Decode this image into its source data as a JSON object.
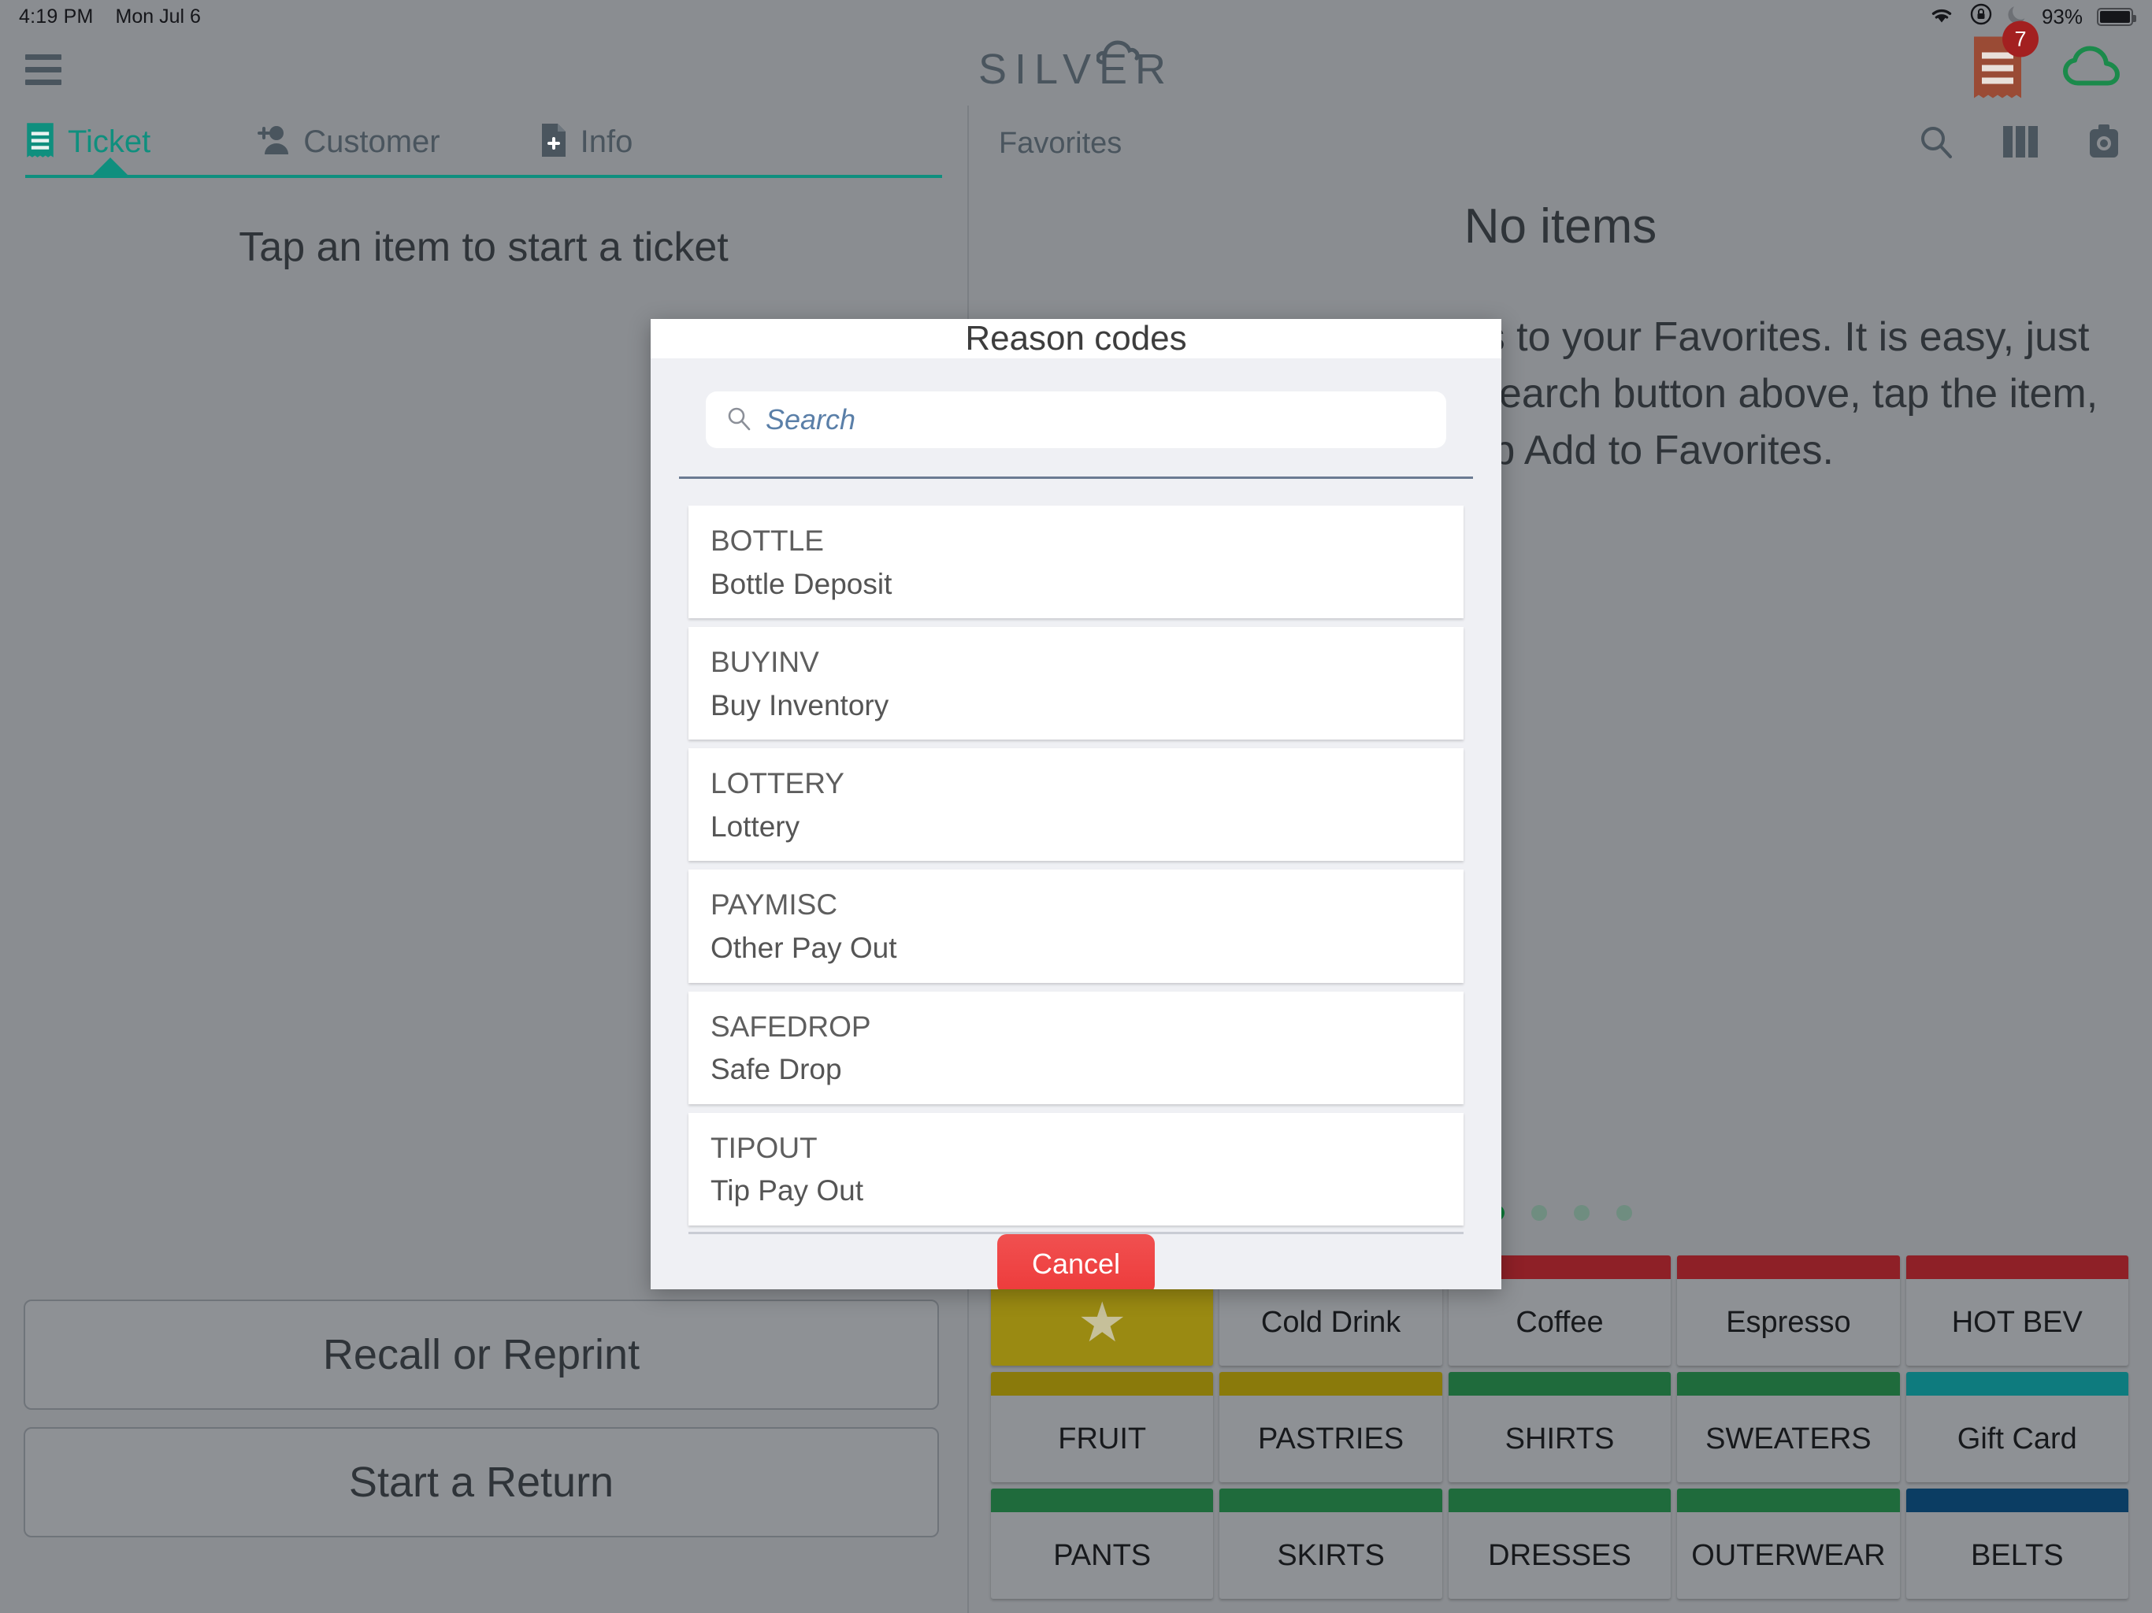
{
  "status_bar": {
    "time": "4:19 PM",
    "date": "Mon Jul 6",
    "battery_percent": "93%",
    "icons": [
      "wifi-icon",
      "rotation-lock-icon",
      "do-not-disturb-moon-icon",
      "battery-icon"
    ]
  },
  "top_bar": {
    "menu_icon": "hamburger-menu-icon",
    "brand": "SILVER",
    "brand_cloud_icon": "cloud-icon",
    "receipt_icon": "receipt-icon",
    "receipt_badge": "7",
    "sync_cloud_icon": "cloud-sync-icon",
    "badge_color": "#a32020",
    "sync_color": "#1b8a4b"
  },
  "left_panel": {
    "tabs": [
      {
        "label": "Ticket",
        "icon": "receipt-icon",
        "active": true
      },
      {
        "label": "Customer",
        "icon": "add-person-icon",
        "active": false
      },
      {
        "label": "Info",
        "icon": "document-add-icon",
        "active": false
      }
    ],
    "accent_color": "#0f8f7e",
    "hint": "Tap an item to start a ticket",
    "actions": [
      {
        "label": "Recall or Reprint"
      },
      {
        "label": "Start a Return"
      }
    ]
  },
  "right_panel": {
    "title": "Favorites",
    "header_icons": [
      "search-icon",
      "columns-layout-icon",
      "camera-icon"
    ],
    "empty_title": "No items",
    "empty_body": "Add your most used items to your Favorites. It is easy, just find an item by using the search button above, tap the item, and then tap Add to Favorites.",
    "page_dots": {
      "count": 4,
      "active_index": 0,
      "active_color": "#0b7a38",
      "inactive_color": "#6f8d80"
    },
    "categories": [
      {
        "label": "",
        "icon": "star-icon",
        "strip": "#9a8a12",
        "tile": "#9a8a12",
        "is_favorites": true
      },
      {
        "label": "Cold Drink",
        "strip": "#8e2027"
      },
      {
        "label": "Coffee",
        "strip": "#8e2027"
      },
      {
        "label": "Espresso",
        "strip": "#8e2027"
      },
      {
        "label": "HOT BEV",
        "strip": "#8e2027"
      },
      {
        "label": "FRUIT",
        "strip": "#8a7a0b"
      },
      {
        "label": "PASTRIES",
        "strip": "#8a7a0b"
      },
      {
        "label": "SHIRTS",
        "strip": "#1f6b3c"
      },
      {
        "label": "SWEATERS",
        "strip": "#1f6b3c"
      },
      {
        "label": "Gift Card",
        "strip": "#0e7b7e"
      },
      {
        "label": "PANTS",
        "strip": "#1f6b3c"
      },
      {
        "label": "SKIRTS",
        "strip": "#1f6b3c"
      },
      {
        "label": "DRESSES",
        "strip": "#1f6b3c"
      },
      {
        "label": "OUTERWEAR",
        "strip": "#1f6b3c"
      },
      {
        "label": "BELTS",
        "strip": "#0b3d63"
      }
    ]
  },
  "modal": {
    "title": "Reason codes",
    "search_placeholder": "Search",
    "search_value": "",
    "search_icon": "search-icon",
    "cancel_label": "Cancel",
    "cancel_color": "#ee3b3b",
    "reason_codes": [
      {
        "code": "BOTTLE",
        "description": "Bottle Deposit"
      },
      {
        "code": "BUYINV",
        "description": "Buy Inventory"
      },
      {
        "code": "LOTTERY",
        "description": "Lottery"
      },
      {
        "code": "PAYMISC",
        "description": "Other Pay Out"
      },
      {
        "code": "SAFEDROP",
        "description": "Safe Drop"
      },
      {
        "code": "TIPOUT",
        "description": "Tip Pay Out"
      }
    ]
  }
}
